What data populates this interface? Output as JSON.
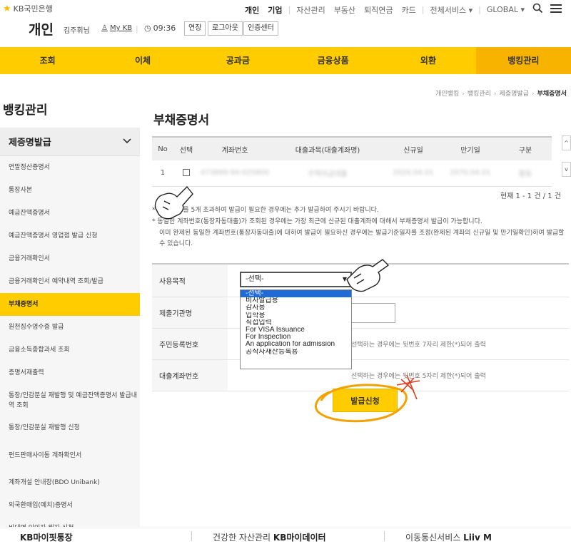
{
  "header": {
    "logo_text": "KB국민은행",
    "nav": [
      "개인",
      "기업",
      "자산관리",
      "부동산",
      "퇴직연금",
      "카드",
      "전체서비스 ▾",
      "GLOBAL ▾"
    ],
    "page_label": "개인",
    "user_name": "김주휘님",
    "my_kb": "My KB",
    "timer": "09:36",
    "extend": "연장",
    "logout": "로그아웃",
    "cert_center": "인증센터"
  },
  "main_nav": [
    "조회",
    "이체",
    "공과금",
    "금융상품",
    "외환",
    "뱅킹관리"
  ],
  "breadcrumb": [
    "개인뱅킹",
    "뱅킹관리",
    "제증명발급",
    "부채증명서"
  ],
  "sidebar": {
    "title": "뱅킹관리",
    "section": "제증명발급",
    "items": [
      "연말정산증명서",
      "통장사본",
      "예금잔액증명서",
      "예금잔액증명서 영업점 발급 신청",
      "금융거래확인서",
      "금융거래확인서 예약내역 조회/발급",
      "부채증명서",
      "원천징수영수증 발급",
      "금융소득종합과세 조회",
      "증명서재출력",
      "통장/인감분실 재발행 및 예금잔액증명서 발급내역 조회",
      "통장/인감분실 재발행 신청",
      "펀드판매사이동 계좌확인서",
      "계좌개설 안내장(BDO Unibank)",
      "외국환매입(예치)증명서",
      "비대면 인인자 해지 신청"
    ]
  },
  "content": {
    "title": "부채증명서",
    "table": {
      "headers": [
        "No",
        "선택",
        "계좌번호",
        "대출과목(대출계좌명)",
        "신규일",
        "만기일",
        "구분"
      ],
      "rows": [
        [
          "1",
          "",
          "473899-94-025800",
          "주택자금대출",
          "2020.04.01",
          "2070.04.01",
          "활동"
        ]
      ]
    },
    "count": "현재 1 - 1 건 / 1 건",
    "notes": [
      "대출 계좌를 5개 초과하여 발급이 필요한 경우에는 추가 발급하여 주시기 바랍니다.",
      "동일한 계좌번호(통장자동대출)가 조회된 경우에는 가장 최근에 신규된 대출계좌에 대해서 부채증명서 발급이 가능합니다.",
      "이미 완제된 동일한 계좌번호(통장자동대출)에 대하여 발급이 필요하신 경우에는 발급기준일자를 조정(완제된 계좌의 신규일 및 만기일확인)하여 발급할 수 있습니다."
    ],
    "form": {
      "purpose_label": "사용목적",
      "purpose_value": "-선택-",
      "submit_to_label": "제출기관명",
      "resident_label": "주민등록번호",
      "resident_help": "선택하는 경우에는 뒷번호 7자리 제한(*)되어 출력",
      "loan_label": "대출계좌번호",
      "loan_help": "선택하는 경우에는 뒷번호 5자리 제한(*)되어 출력"
    },
    "dropdown_options": [
      "-선택-",
      "비자발급용",
      "감사용",
      "입학용",
      "직접입력",
      "For VISA Issuance",
      "For Inspection",
      "An application for admission",
      "공작자재산등록용"
    ],
    "issue_button": "발급신청"
  },
  "bottom_banner": [
    {
      "strong": "KB마이핏통장",
      "dim": ""
    },
    {
      "dim": "건강한 자산관리 ",
      "strong": "KB마이데이터"
    },
    {
      "dim": "이동통신서비스 ",
      "strong": "Liiv M"
    }
  ]
}
